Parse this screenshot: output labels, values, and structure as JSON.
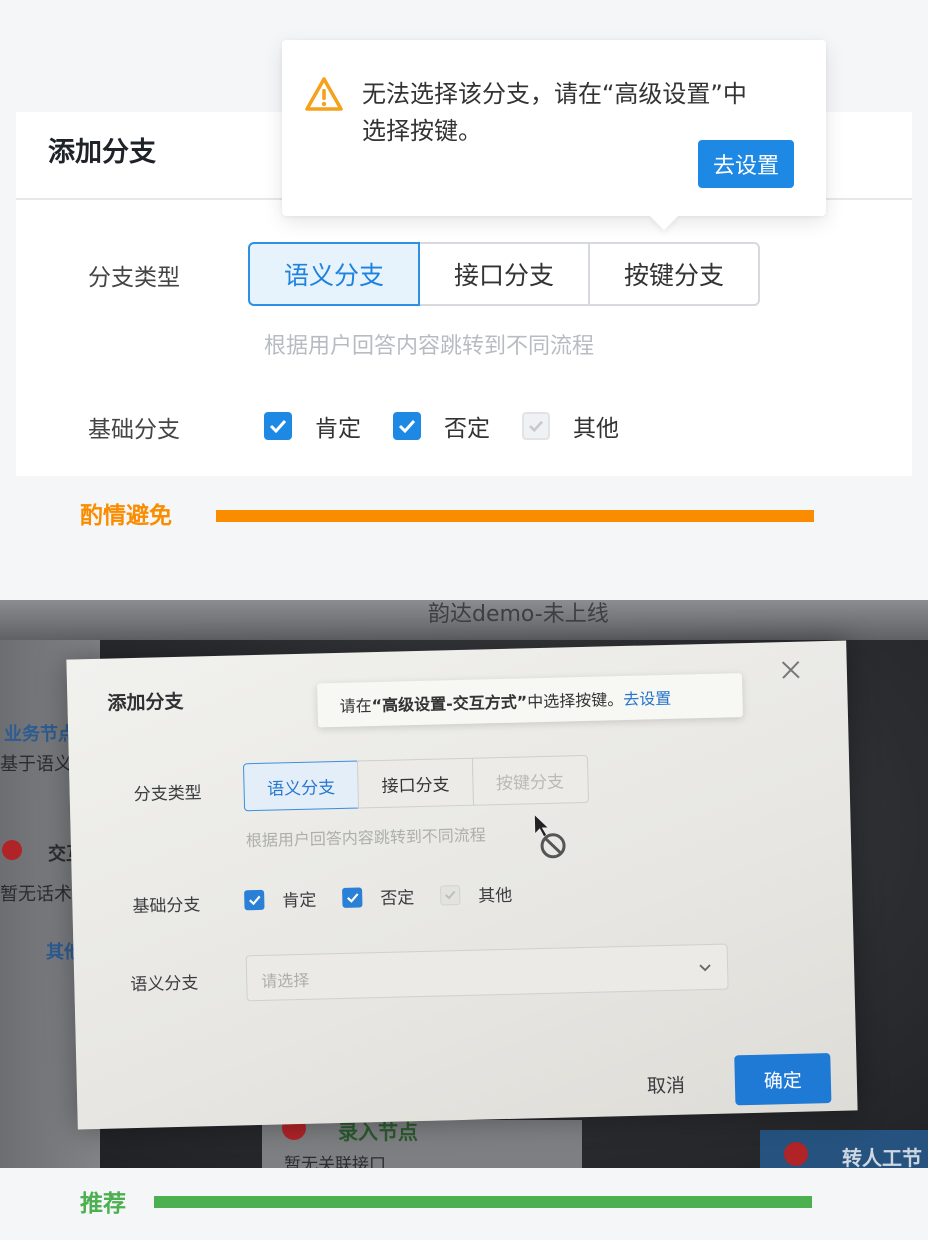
{
  "top_example": {
    "title": "添加分支",
    "branch_type_label": "分支类型",
    "segments": [
      "语义分支",
      "接口分支",
      "按键分支"
    ],
    "active_segment": "语义分支",
    "hint": "根据用户回答内容跳转到不同流程",
    "basic_branch_label": "基础分支",
    "checkboxes": [
      {
        "label": "肯定",
        "checked": true,
        "disabled": false
      },
      {
        "label": "否定",
        "checked": true,
        "disabled": false
      },
      {
        "label": "其他",
        "checked": true,
        "disabled": true
      }
    ],
    "tooltip": {
      "icon": "warning-triangle-icon",
      "line1": "无法选择该分支，请在“高级设置”中",
      "line2": "选择按键。",
      "button": "去设置"
    }
  },
  "verdict_bad": {
    "label": "酌情避免",
    "color": "#fa8c00"
  },
  "photo_example": {
    "app_title": "韵达demo-未上线",
    "left_panel": [
      "业务节点",
      "基于语义判",
      "交互",
      "暂无话术",
      "其他"
    ],
    "dialog_title": "添加分支",
    "tooltip": {
      "prefix": "请在",
      "bold": "“高级设置-交互方式”",
      "suffix": "中选择按键。",
      "link": "去设置"
    },
    "branch_type_label": "分支类型",
    "segments": [
      "语义分支",
      "接口分支",
      "按键分支"
    ],
    "hint": "根据用户回答内容跳转到不同流程",
    "basic_branch_label": "基础分支",
    "checkboxes": [
      "肯定",
      "否定",
      "其他"
    ],
    "semantic_label": "语义分支",
    "select_placeholder": "请选择",
    "cancel": "取消",
    "confirm": "确定",
    "bg_bottom": "录入节点",
    "bg_bottom_sub": "暂无关联接口",
    "bg_right": "转人工节"
  },
  "verdict_good": {
    "label": "推荐",
    "color": "#4caf50"
  }
}
